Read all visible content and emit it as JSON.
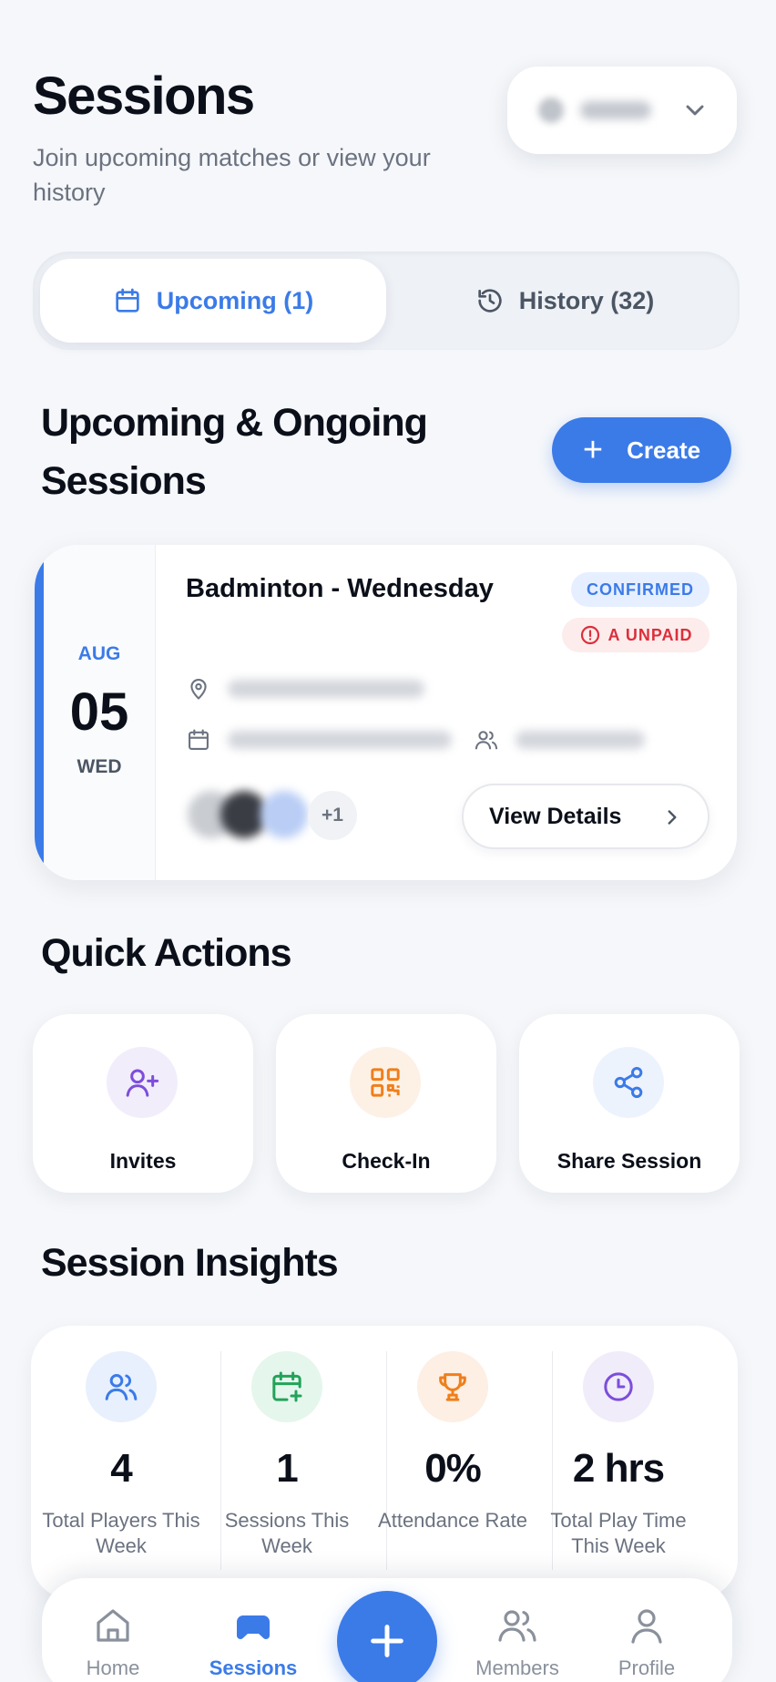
{
  "header": {
    "title": "Sessions",
    "subtitle": "Join upcoming matches or view your history"
  },
  "group_select": {
    "icon": "chevron-down-icon"
  },
  "tabs": [
    {
      "label": "Upcoming (1)",
      "icon": "calendar-icon",
      "active": true
    },
    {
      "label": "History (32)",
      "icon": "history-icon",
      "active": false
    }
  ],
  "upcoming": {
    "title": "Upcoming & Ongoing Sessions",
    "create_label": "Create"
  },
  "session": {
    "month": "AUG",
    "day": "05",
    "weekday": "WED",
    "name": "Badminton - Wednesday",
    "status": "CONFIRMED",
    "payment": "A UNPAID",
    "more_players": "+1",
    "view_label": "View Details"
  },
  "quick_actions": {
    "title": "Quick Actions",
    "items": [
      {
        "label": "Invites",
        "icon": "add-user-icon",
        "color": "#7c4ddb"
      },
      {
        "label": "Check-In",
        "icon": "qr-code-icon",
        "color": "#f07f1a"
      },
      {
        "label": "Share Session",
        "icon": "share-icon",
        "color": "#3b7be8"
      }
    ]
  },
  "insights": {
    "title": "Session Insights",
    "items": [
      {
        "value": "4",
        "label": "Total Players This Week",
        "icon": "users-icon",
        "color": "#3b7be8"
      },
      {
        "value": "1",
        "label": "Sessions This Week",
        "icon": "calendar-plus-icon",
        "color": "#22a35a"
      },
      {
        "value": "0%",
        "label": "Attendance Rate",
        "icon": "trophy-icon",
        "color": "#f07f1a"
      },
      {
        "value": "2 hrs",
        "label": "Total Play Time This Week",
        "icon": "clock-icon",
        "color": "#7c4ddb"
      }
    ]
  },
  "nav": {
    "items": [
      {
        "label": "Home",
        "icon": "home-icon"
      },
      {
        "label": "Sessions",
        "icon": "gamepad-icon",
        "active": true
      },
      {
        "label": "Members",
        "icon": "members-icon"
      },
      {
        "label": "Profile",
        "icon": "profile-icon"
      }
    ],
    "fab_icon": "plus-icon"
  },
  "colors": {
    "accent": "#3b7be8",
    "danger": "#dc2f3b",
    "background": "#f5f7fa"
  }
}
